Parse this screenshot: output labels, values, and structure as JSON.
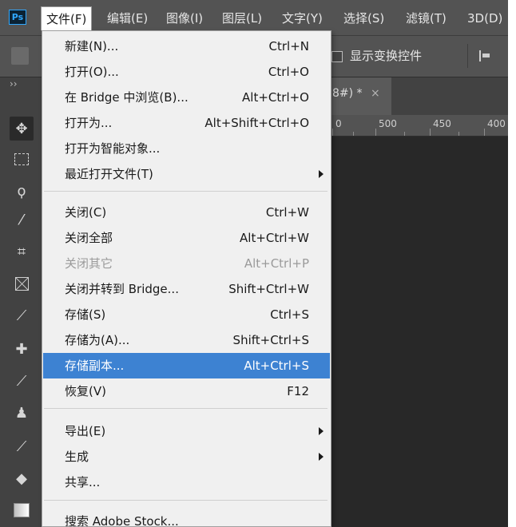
{
  "app": {
    "logo": "Ps"
  },
  "menubar": {
    "items": [
      "文件(F)",
      "编辑(E)",
      "图像(I)",
      "图层(L)",
      "文字(Y)",
      "选择(S)",
      "滤镜(T)",
      "3D(D)"
    ]
  },
  "options": {
    "show_transform_label": "显示变换控件"
  },
  "tabs": {
    "collapse_glyph": "››",
    "doc_tab_label": "8#) *",
    "doc_tab_close": "×"
  },
  "ruler": {
    "labels": [
      "0",
      "500",
      "450",
      "400"
    ]
  },
  "file_menu": {
    "items": [
      {
        "label": "新建(N)...",
        "shortcut": "Ctrl+N"
      },
      {
        "label": "打开(O)...",
        "shortcut": "Ctrl+O"
      },
      {
        "label": "在 Bridge 中浏览(B)...",
        "shortcut": "Alt+Ctrl+O"
      },
      {
        "label": "打开为...",
        "shortcut": "Alt+Shift+Ctrl+O"
      },
      {
        "label": "打开为智能对象...",
        "shortcut": ""
      },
      {
        "label": "最近打开文件(T)",
        "shortcut": ""
      },
      {
        "label": "关闭(C)",
        "shortcut": "Ctrl+W"
      },
      {
        "label": "关闭全部",
        "shortcut": "Alt+Ctrl+W"
      },
      {
        "label": "关闭其它",
        "shortcut": "Alt+Ctrl+P"
      },
      {
        "label": "关闭并转到 Bridge...",
        "shortcut": "Shift+Ctrl+W"
      },
      {
        "label": "存储(S)",
        "shortcut": "Ctrl+S"
      },
      {
        "label": "存储为(A)...",
        "shortcut": "Shift+Ctrl+S"
      },
      {
        "label": "存储副本...",
        "shortcut": "Alt+Ctrl+S"
      },
      {
        "label": "恢复(V)",
        "shortcut": "F12"
      },
      {
        "label": "导出(E)",
        "shortcut": ""
      },
      {
        "label": "生成",
        "shortcut": ""
      },
      {
        "label": "共享...",
        "shortcut": ""
      },
      {
        "label": "搜索 Adobe Stock...",
        "shortcut": ""
      }
    ]
  },
  "colors": {
    "highlight": "#3d82d2",
    "menubar_bg": "#535353",
    "canvas_bg": "#282828"
  }
}
